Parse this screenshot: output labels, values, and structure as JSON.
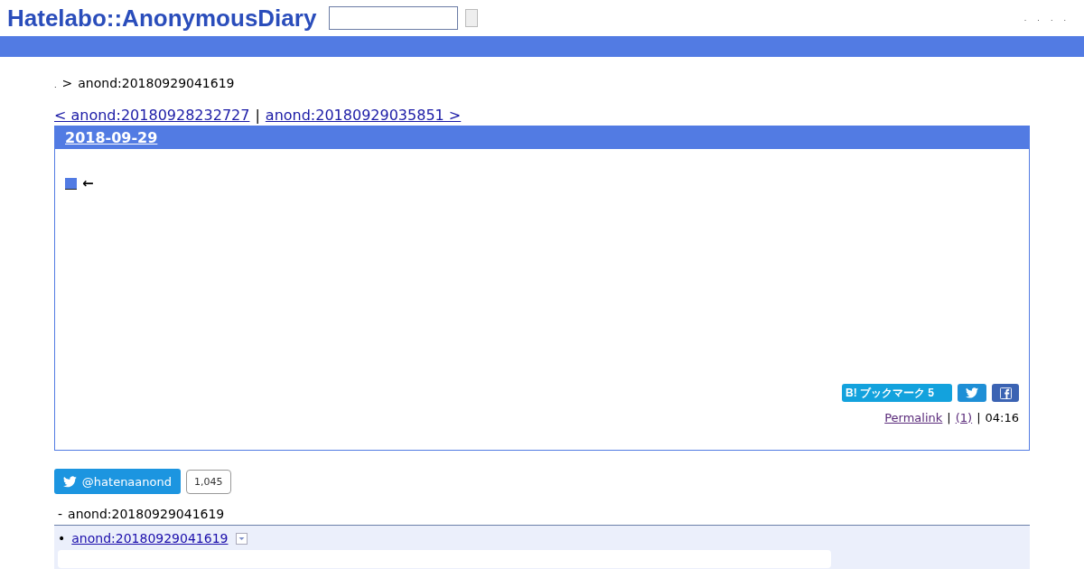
{
  "header": {
    "logo": "Hatelabo::AnonymousDiary",
    "nav_marks": [
      ".",
      ".",
      ".",
      "."
    ]
  },
  "breadcrumb": {
    "home": ".",
    "separator": ">",
    "current": "anond:20180929041619"
  },
  "pager": {
    "prev": "< anond:20180928232727",
    "separator": "|",
    "next": "anond:20180929035851 >"
  },
  "entry": {
    "date": "2018-09-29",
    "arrow": "←",
    "bookmark": {
      "label": "B! ブックマーク 5"
    },
    "footer": {
      "permalink": "Permalink",
      "sep1": "|",
      "comments": "(1)",
      "sep2": "|",
      "time": "04:16"
    }
  },
  "follow": {
    "handle": "@hatenaanond",
    "count": "1,045"
  },
  "refs": {
    "dash": "-",
    "title": "anond:20180929041619",
    "items": [
      {
        "bullet": "•",
        "link": "anond:20180929041619"
      }
    ]
  }
}
